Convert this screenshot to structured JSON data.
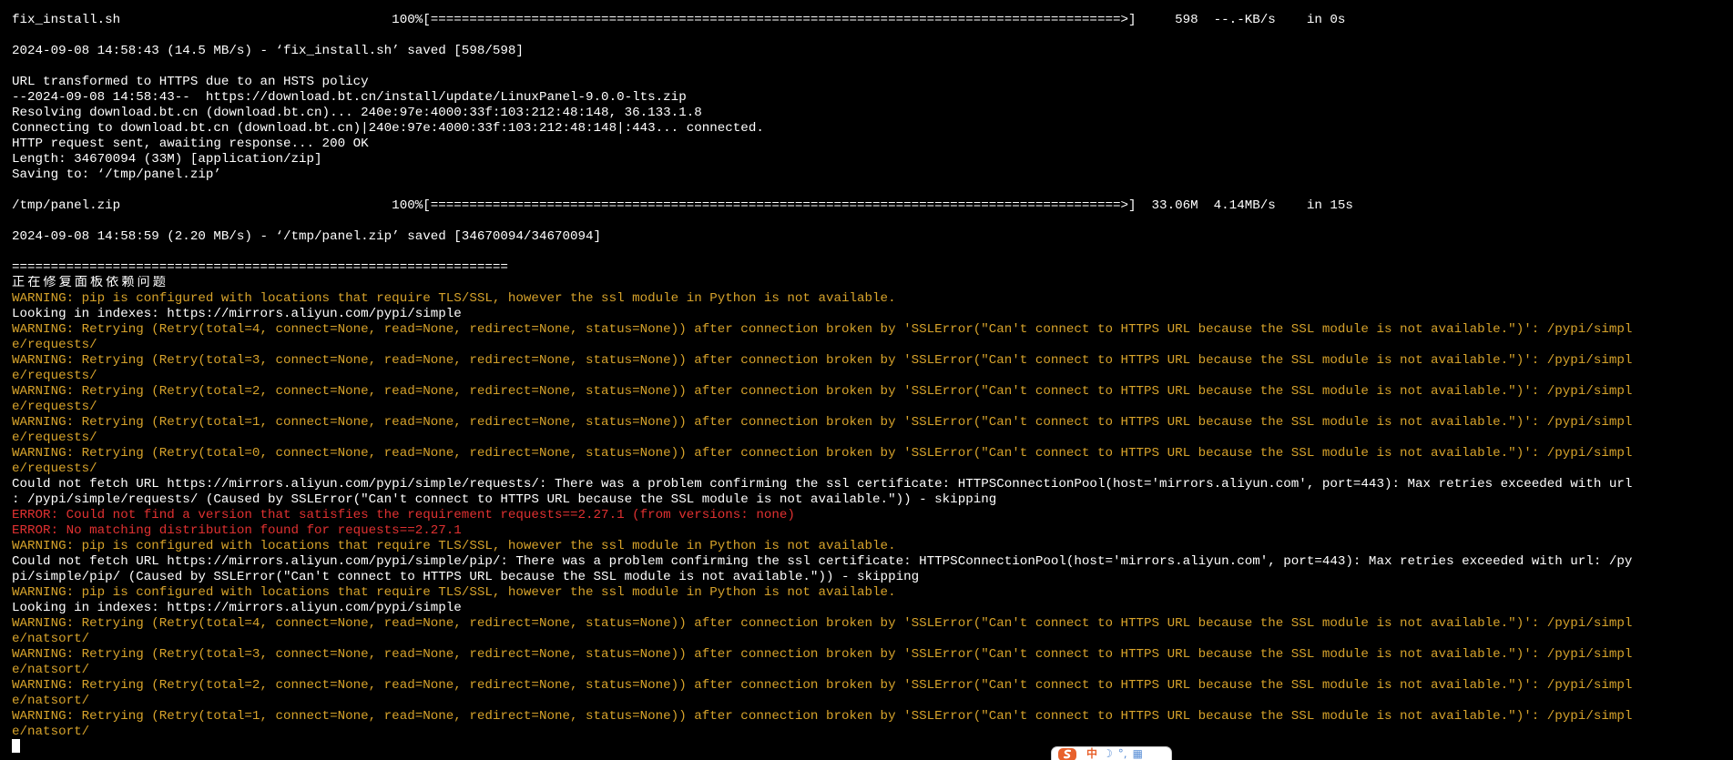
{
  "terminal": {
    "lines": [
      {
        "text": "fix_install.sh                                   100%[=========================================================================================>]     598  --.-KB/s    in 0s",
        "color": "normal"
      },
      {
        "text": "",
        "color": "normal"
      },
      {
        "text": "2024-09-08 14:58:43 (14.5 MB/s) - ‘fix_install.sh’ saved [598/598]",
        "color": "normal"
      },
      {
        "text": "",
        "color": "normal"
      },
      {
        "text": "URL transformed to HTTPS due to an HSTS policy",
        "color": "normal"
      },
      {
        "text": "--2024-09-08 14:58:43--  https://download.bt.cn/install/update/LinuxPanel-9.0.0-lts.zip",
        "color": "normal"
      },
      {
        "text": "Resolving download.bt.cn (download.bt.cn)... 240e:97e:4000:33f:103:212:48:148, 36.133.1.8",
        "color": "normal"
      },
      {
        "text": "Connecting to download.bt.cn (download.bt.cn)|240e:97e:4000:33f:103:212:48:148|:443... connected.",
        "color": "normal"
      },
      {
        "text": "HTTP request sent, awaiting response... 200 OK",
        "color": "normal"
      },
      {
        "text": "Length: 34670094 (33M) [application/zip]",
        "color": "normal"
      },
      {
        "text": "Saving to: ‘/tmp/panel.zip’",
        "color": "normal"
      },
      {
        "text": "",
        "color": "normal"
      },
      {
        "text": "/tmp/panel.zip                                   100%[=========================================================================================>]  33.06M  4.14MB/s    in 15s",
        "color": "normal"
      },
      {
        "text": "",
        "color": "normal"
      },
      {
        "text": "2024-09-08 14:58:59 (2.20 MB/s) - ‘/tmp/panel.zip’ saved [34670094/34670094]",
        "color": "normal"
      },
      {
        "text": "",
        "color": "normal"
      },
      {
        "text": "================================================================",
        "color": "normal"
      },
      {
        "text": "正在修复面板依赖问题",
        "color": "cjk"
      },
      {
        "text": "WARNING: pip is configured with locations that require TLS/SSL, however the ssl module in Python is not available.",
        "color": "warn"
      },
      {
        "text": "Looking in indexes: https://mirrors.aliyun.com/pypi/simple",
        "color": "normal"
      },
      {
        "text": "WARNING: Retrying (Retry(total=4, connect=None, read=None, redirect=None, status=None)) after connection broken by 'SSLError(\"Can't connect to HTTPS URL because the SSL module is not available.\")': /pypi/simpl",
        "color": "warn"
      },
      {
        "text": "e/requests/",
        "color": "warn"
      },
      {
        "text": "WARNING: Retrying (Retry(total=3, connect=None, read=None, redirect=None, status=None)) after connection broken by 'SSLError(\"Can't connect to HTTPS URL because the SSL module is not available.\")': /pypi/simpl",
        "color": "warn"
      },
      {
        "text": "e/requests/",
        "color": "warn"
      },
      {
        "text": "WARNING: Retrying (Retry(total=2, connect=None, read=None, redirect=None, status=None)) after connection broken by 'SSLError(\"Can't connect to HTTPS URL because the SSL module is not available.\")': /pypi/simpl",
        "color": "warn"
      },
      {
        "text": "e/requests/",
        "color": "warn"
      },
      {
        "text": "WARNING: Retrying (Retry(total=1, connect=None, read=None, redirect=None, status=None)) after connection broken by 'SSLError(\"Can't connect to HTTPS URL because the SSL module is not available.\")': /pypi/simpl",
        "color": "warn"
      },
      {
        "text": "e/requests/",
        "color": "warn"
      },
      {
        "text": "WARNING: Retrying (Retry(total=0, connect=None, read=None, redirect=None, status=None)) after connection broken by 'SSLError(\"Can't connect to HTTPS URL because the SSL module is not available.\")': /pypi/simpl",
        "color": "warn"
      },
      {
        "text": "e/requests/",
        "color": "warn"
      },
      {
        "text": "Could not fetch URL https://mirrors.aliyun.com/pypi/simple/requests/: There was a problem confirming the ssl certificate: HTTPSConnectionPool(host='mirrors.aliyun.com', port=443): Max retries exceeded with url",
        "color": "normal"
      },
      {
        "text": ": /pypi/simple/requests/ (Caused by SSLError(\"Can't connect to HTTPS URL because the SSL module is not available.\")) - skipping",
        "color": "normal"
      },
      {
        "text": "ERROR: Could not find a version that satisfies the requirement requests==2.27.1 (from versions: none)",
        "color": "error"
      },
      {
        "text": "ERROR: No matching distribution found for requests==2.27.1",
        "color": "error"
      },
      {
        "text": "WARNING: pip is configured with locations that require TLS/SSL, however the ssl module in Python is not available.",
        "color": "warn"
      },
      {
        "text": "Could not fetch URL https://mirrors.aliyun.com/pypi/simple/pip/: There was a problem confirming the ssl certificate: HTTPSConnectionPool(host='mirrors.aliyun.com', port=443): Max retries exceeded with url: /py",
        "color": "normal"
      },
      {
        "text": "pi/simple/pip/ (Caused by SSLError(\"Can't connect to HTTPS URL because the SSL module is not available.\")) - skipping",
        "color": "normal"
      },
      {
        "text": "WARNING: pip is configured with locations that require TLS/SSL, however the ssl module in Python is not available.",
        "color": "warn"
      },
      {
        "text": "Looking in indexes: https://mirrors.aliyun.com/pypi/simple",
        "color": "normal"
      },
      {
        "text": "WARNING: Retrying (Retry(total=4, connect=None, read=None, redirect=None, status=None)) after connection broken by 'SSLError(\"Can't connect to HTTPS URL because the SSL module is not available.\")': /pypi/simpl",
        "color": "warn"
      },
      {
        "text": "e/natsort/",
        "color": "warn"
      },
      {
        "text": "WARNING: Retrying (Retry(total=3, connect=None, read=None, redirect=None, status=None)) after connection broken by 'SSLError(\"Can't connect to HTTPS URL because the SSL module is not available.\")': /pypi/simpl",
        "color": "warn"
      },
      {
        "text": "e/natsort/",
        "color": "warn"
      },
      {
        "text": "WARNING: Retrying (Retry(total=2, connect=None, read=None, redirect=None, status=None)) after connection broken by 'SSLError(\"Can't connect to HTTPS URL because the SSL module is not available.\")': /pypi/simpl",
        "color": "warn"
      },
      {
        "text": "e/natsort/",
        "color": "warn"
      },
      {
        "text": "WARNING: Retrying (Retry(total=1, connect=None, read=None, redirect=None, status=None)) after connection broken by 'SSLError(\"Can't connect to HTTPS URL because the SSL module is not available.\")': /pypi/simpl",
        "color": "warn"
      },
      {
        "text": "e/natsort/",
        "color": "warn"
      }
    ]
  },
  "colors": {
    "background": "#000000",
    "text": "#ffffff",
    "warning": "#d7a32b",
    "error": "#e03131",
    "ime_accent": "#e8612c"
  },
  "ime_toolbar": {
    "language_label": "中",
    "icons": [
      "sogou-logo-icon",
      "moon-icon",
      "punctuation-icon",
      "keyboard-grid-icon"
    ]
  }
}
